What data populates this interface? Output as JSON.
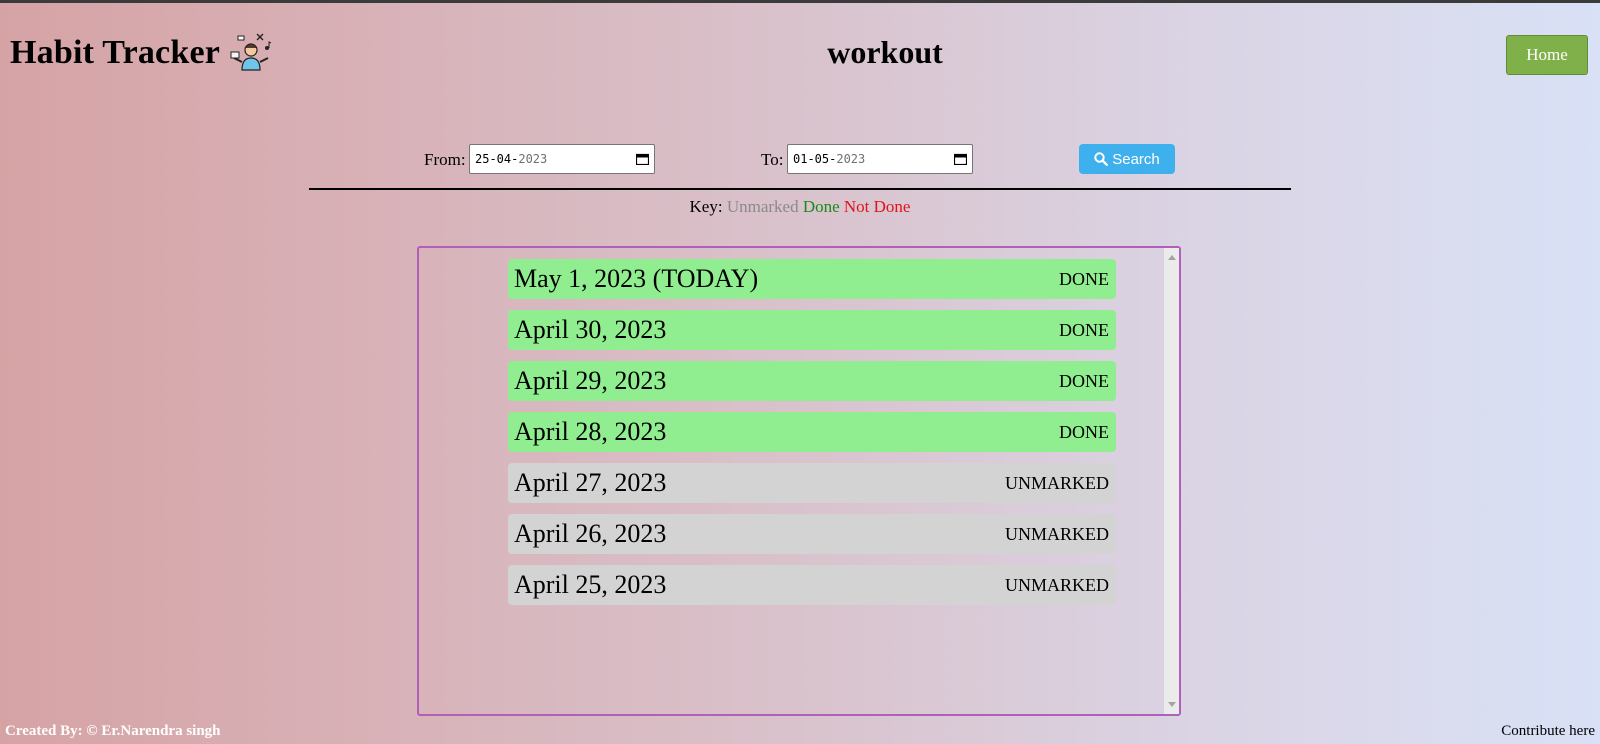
{
  "header": {
    "brand_title": "Habit Tracker",
    "page_title": "workout",
    "home_label": "Home"
  },
  "filter": {
    "from_label": "From:",
    "from_value_day_month": "25-04-",
    "from_value_year": "2023",
    "to_label": "To:",
    "to_value_day_month": "01-05-",
    "to_value_year": "2023",
    "search_label": "Search"
  },
  "key": {
    "label": "Key:",
    "unmarked": "Unmarked",
    "done": "Done",
    "not_done": "Not Done"
  },
  "days": [
    {
      "date": "May 1, 2023 (TODAY)",
      "status": "DONE"
    },
    {
      "date": "April 30, 2023",
      "status": "DONE"
    },
    {
      "date": "April 29, 2023",
      "status": "DONE"
    },
    {
      "date": "April 28, 2023",
      "status": "DONE"
    },
    {
      "date": "April 27, 2023",
      "status": "UNMARKED"
    },
    {
      "date": "April 26, 2023",
      "status": "UNMARKED"
    },
    {
      "date": "April 25, 2023",
      "status": "UNMARKED"
    }
  ],
  "footer": {
    "created_by": "Created By: © Er.Narendra singh",
    "contribute": "Contribute here"
  },
  "colors": {
    "done": "#90ee90",
    "unmarked": "#d3d3d3",
    "home_button": "#7fb04a",
    "search_button": "#3fb0ee",
    "list_border": "#b060b8"
  }
}
